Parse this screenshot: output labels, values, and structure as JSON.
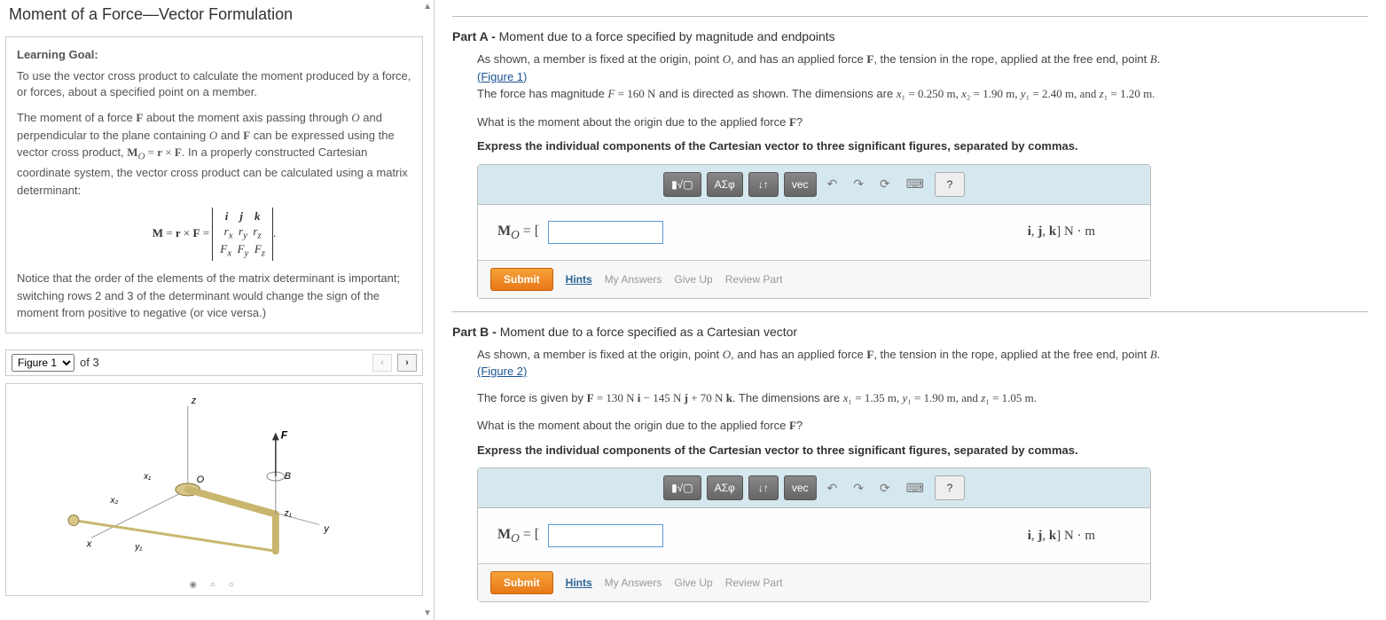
{
  "left": {
    "title": "Moment of a Force—Vector Formulation",
    "goal_label": "Learning Goal:",
    "goal_text": "To use the vector cross product to calculate the moment produced by a force, or forces, about a specified point on a member.",
    "theory_intro": "The moment of a force ",
    "theory_p1_seg1": " about the moment axis passing through ",
    "theory_p1_seg2": " and perpendicular to the plane containing ",
    "theory_p1_seg3": " and ",
    "theory_p1_seg4": " can be expressed using the vector cross product, ",
    "theory_p1_formula": "M_O = r × F",
    "theory_p1_seg5": ". In a properly constructed Cartesian coordinate system, the vector cross product can be calculated using a matrix determinant:",
    "matrix_label": "M = r × F =",
    "matrix_r1": "i    j    k",
    "matrix_r2": "rₓ   r_y   r_z",
    "matrix_r3": "Fₓ   F_y   F_z",
    "theory_p2": "Notice that the order of the elements of the matrix determinant is important; switching rows 2 and 3 of the determinant would change the sign of the moment from positive to negative (or vice versa.)",
    "figure_selected": "Figure 1",
    "figure_count": "of 3"
  },
  "partA": {
    "header": "Part A - ",
    "subtitle": "Moment due to a force specified by magnitude and endpoints",
    "p1_seg1": "As shown, a member is fixed at the origin, point ",
    "p1_seg2": ", and has an applied force ",
    "p1_seg3": ", the tension in the rope, applied at the free end, point ",
    "figure_link": "(Figure 1)",
    "p2_seg1": "The force has magnitude ",
    "F_val": "F = 160 N",
    "p2_seg2": " and is directed as shown. The dimensions are ",
    "dims": "x₁ = 0.250 m, x₂ = 1.90 m, y₁ = 2.40 m, and z₁ = 1.20 m.",
    "question": "What is the moment about the origin due to the applied force ",
    "instr": "Express the individual components of the Cartesian vector to three significant figures, separated by commas.",
    "mo_label": "M_O = [",
    "units": "i, j, k] N · m",
    "submit": "Submit",
    "hints": "Hints",
    "my_answers": "My Answers",
    "give_up": "Give Up",
    "review": "Review Part"
  },
  "partB": {
    "header": "Part B - ",
    "subtitle": "Moment due to a force specified as a Cartesian vector",
    "p1_seg1": "As shown, a member is fixed at the origin, point ",
    "p1_seg2": ", and has an applied force ",
    "p1_seg3": ", the tension in the rope, applied at the free end, point ",
    "figure_link": "(Figure 2)",
    "p2_seg1": "The force is given by ",
    "F_expr": "F = 130 N i − 145 N j + 70 N k",
    "p2_seg2": ". The dimensions are ",
    "dims": "x₁ = 1.35 m, y₁ = 1.90 m, and z₁ = 1.05 m.",
    "question": "What is the moment about the origin due to the applied force ",
    "instr": "Express the individual components of the Cartesian vector to three significant figures, separated by commas.",
    "mo_label": "M_O = [",
    "units": "i, j, k] N · m",
    "submit": "Submit",
    "hints": "Hints",
    "my_answers": "My Answers",
    "give_up": "Give Up",
    "review": "Review Part"
  },
  "toolbar": {
    "t1": "▮√▢",
    "t2": "ΑΣφ",
    "t3": "↓↑",
    "t4": "vec",
    "undo": "↶",
    "redo": "↷",
    "reset": "⟳",
    "keyboard": "⌨",
    "help": "?"
  }
}
